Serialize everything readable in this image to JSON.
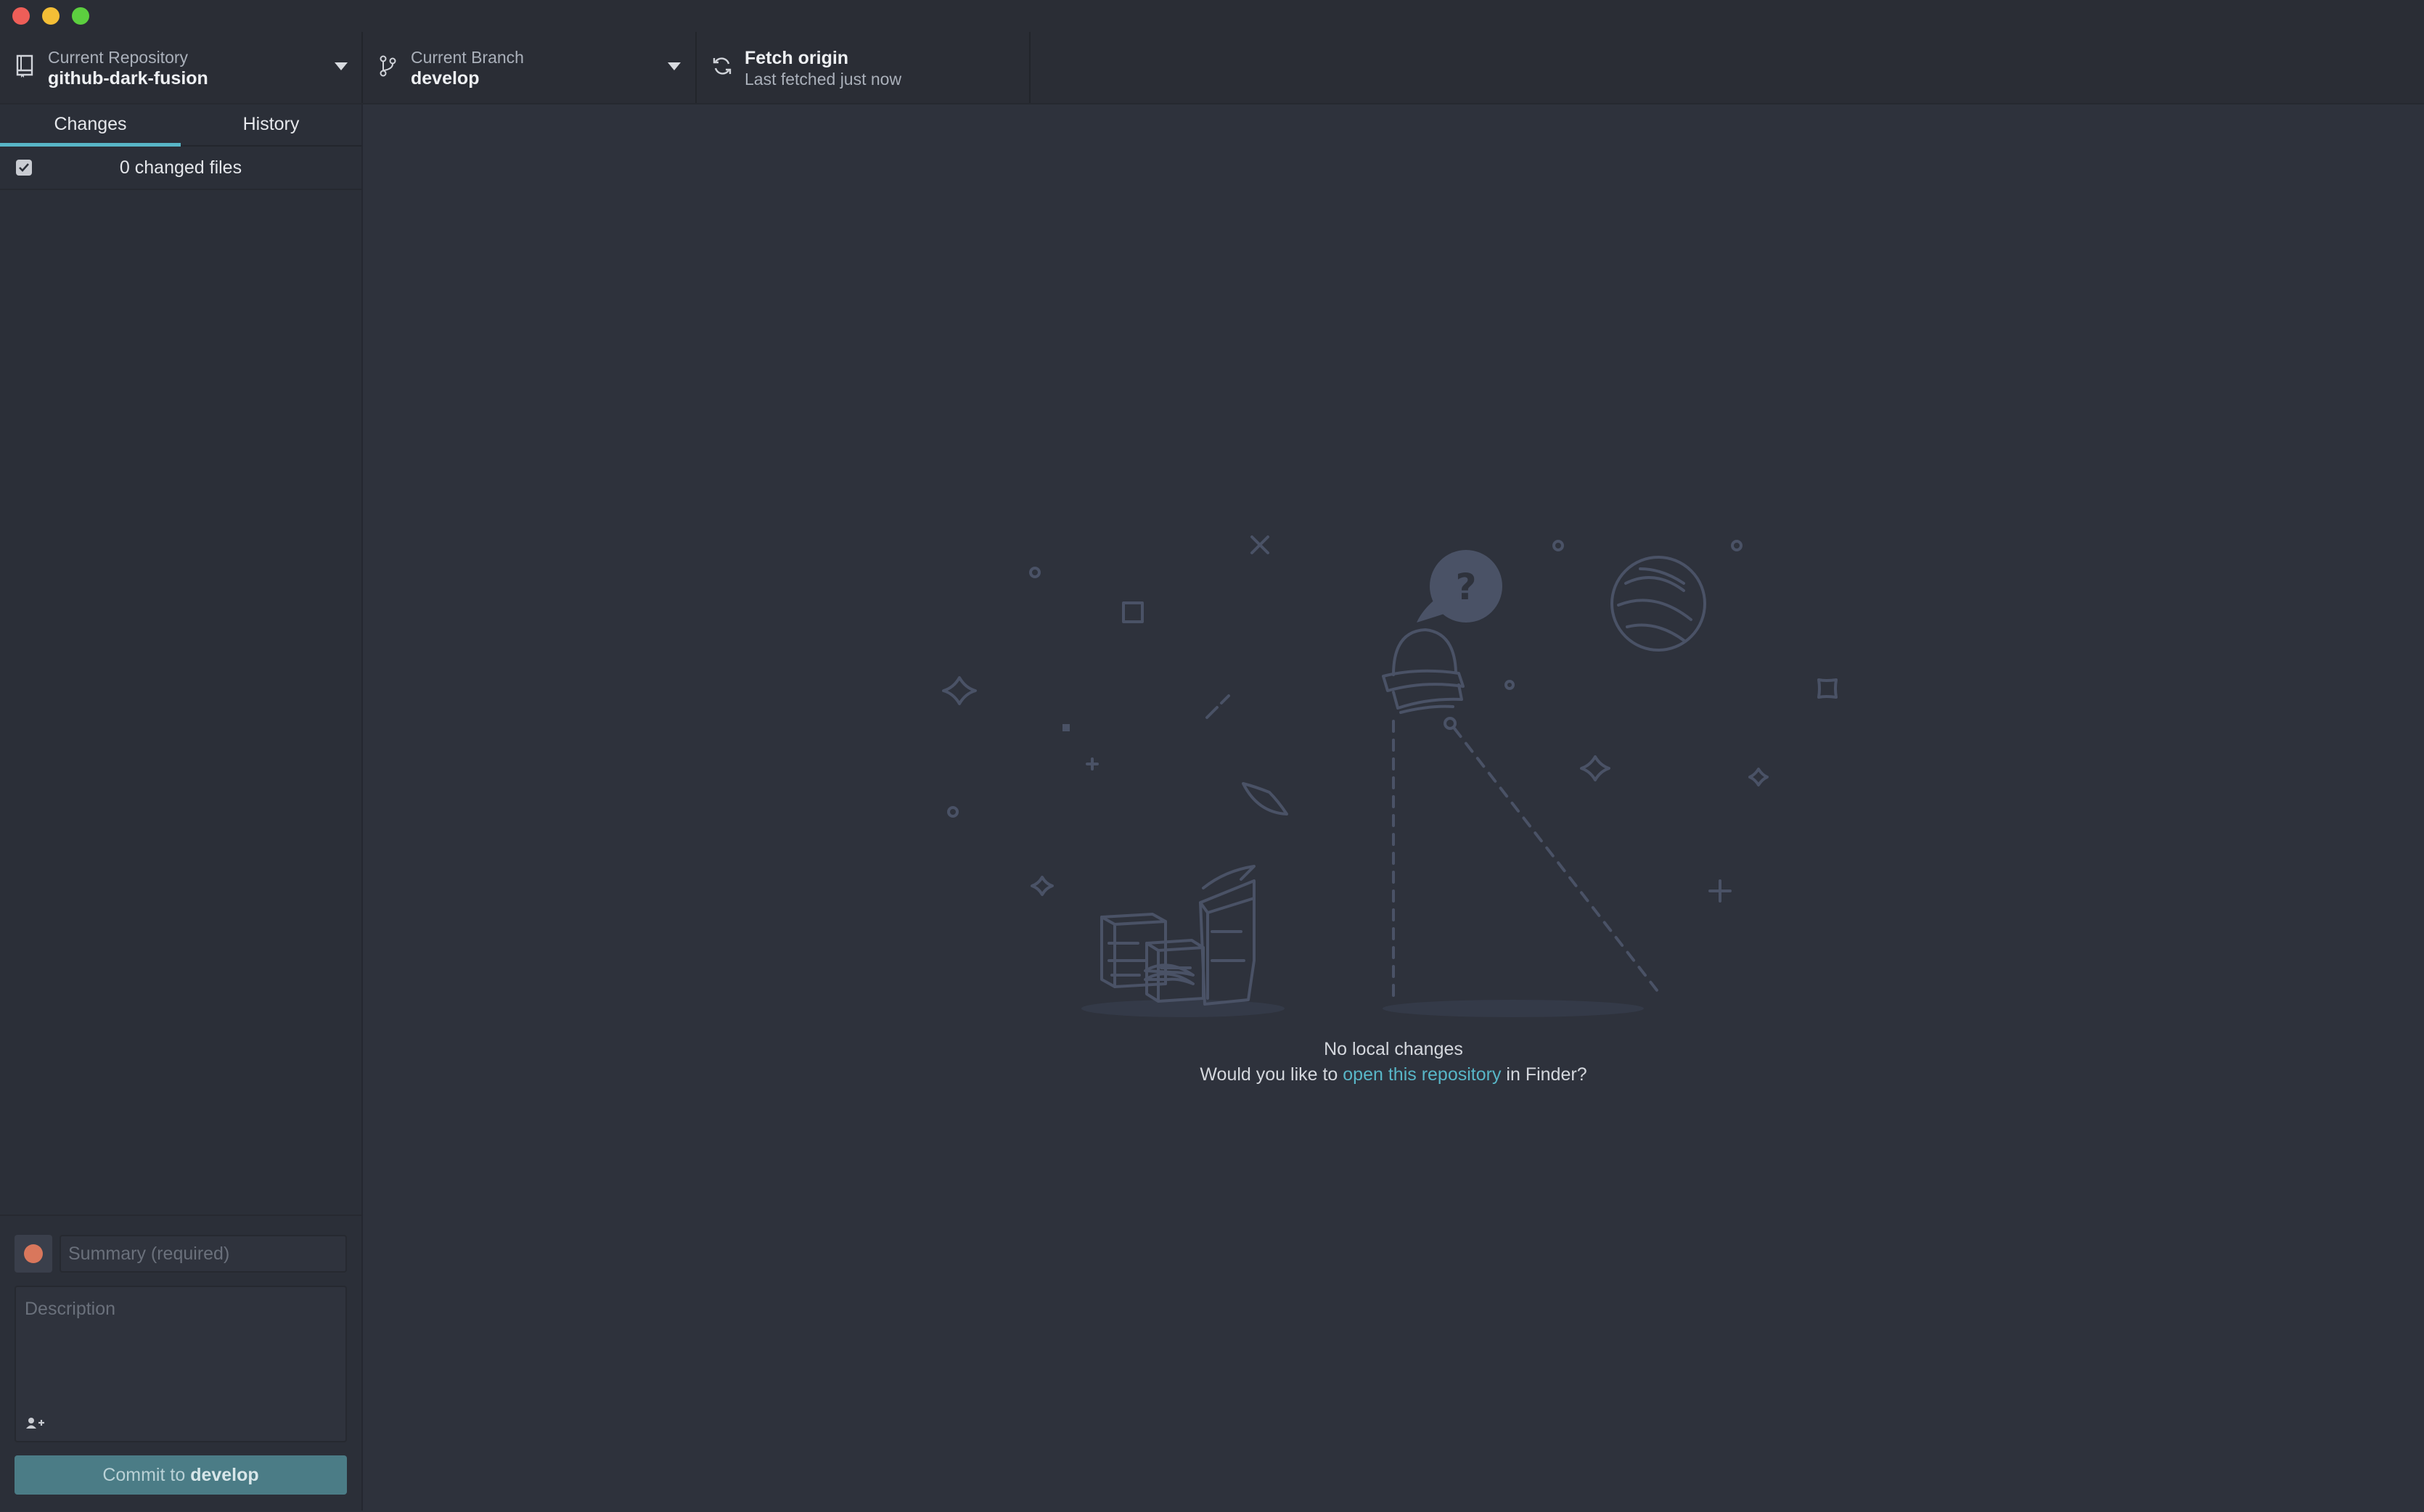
{
  "toolbar": {
    "repository": {
      "label": "Current Repository",
      "value": "github-dark-fusion"
    },
    "branch": {
      "label": "Current Branch",
      "value": "develop"
    },
    "fetch": {
      "label": "Fetch origin",
      "status": "Last fetched just now"
    }
  },
  "sidebar": {
    "tabs": [
      {
        "label": "Changes",
        "active": true
      },
      {
        "label": "History",
        "active": false
      }
    ],
    "changed_files": "0 changed files",
    "commit": {
      "summary_placeholder": "Summary (required)",
      "description_placeholder": "Description",
      "button_prefix": "Commit to",
      "button_branch": "develop"
    }
  },
  "main": {
    "blank_title": "No local changes",
    "blank_prompt_prefix": "Would you like to",
    "blank_link": "open this repository",
    "blank_prompt_suffix": "in Finder?"
  },
  "colors": {
    "accent": "#58b6c7",
    "background": "#2e323c",
    "sidebar": "#2b2f38",
    "commit_button": "#4b7c86",
    "illustration": "#4a5266"
  }
}
